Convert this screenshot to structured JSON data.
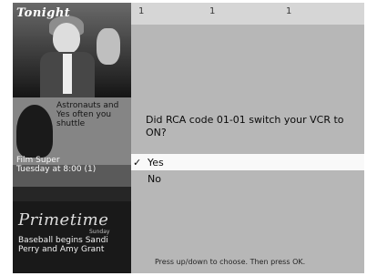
{
  "sidebar": {
    "photo_title": "Tonight",
    "promo_text": "Astronauts and Yes often you shuttle",
    "promo_show": "Film Super",
    "promo_time": "Tuesday at 8:00 (1)",
    "brand_name": "Primetime",
    "brand_sub": "Sunday",
    "brand_desc": "Baseball begins Sandi Perry and Amy Grant"
  },
  "top_bar": {
    "icons": [
      "tv-icon",
      "vcr-icon",
      "cable-icon"
    ],
    "glyphs": [
      "1",
      "1",
      "1"
    ]
  },
  "dialog": {
    "question": "Did RCA code 01-01 switch your VCR to ON?",
    "options": [
      {
        "label": "Yes",
        "selected": true,
        "check": "✓"
      },
      {
        "label": "No",
        "selected": false,
        "check": ""
      }
    ],
    "hint": "Press up/down to choose. Then press OK."
  }
}
